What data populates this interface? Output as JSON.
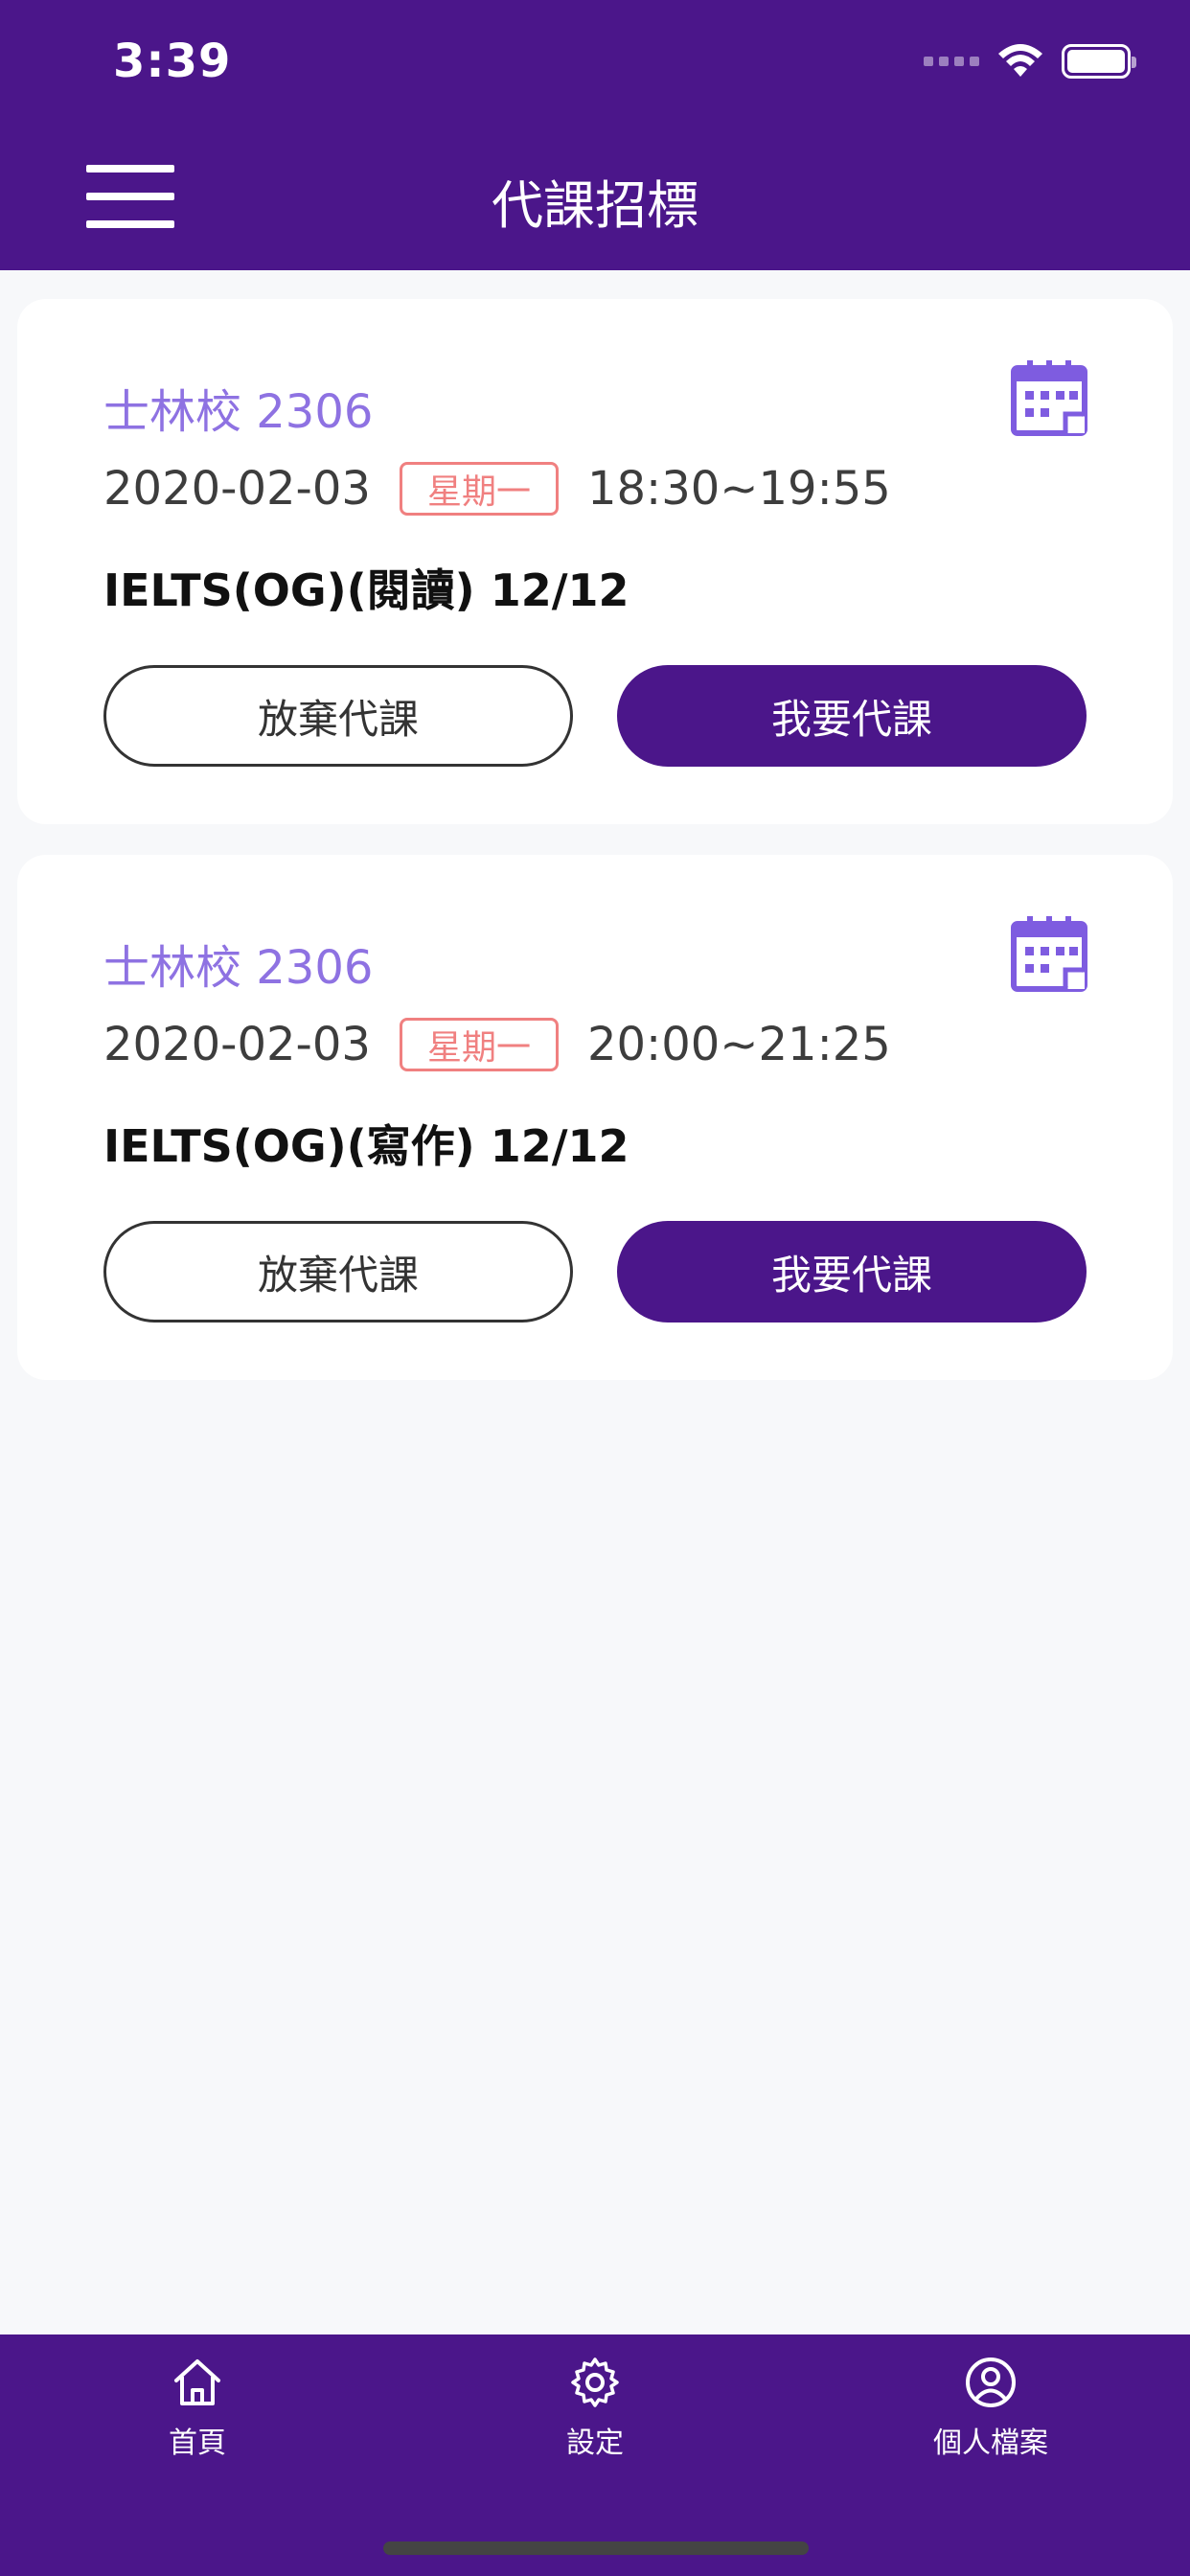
{
  "status_bar": {
    "time": "3:39"
  },
  "header": {
    "title": "代課招標"
  },
  "colors": {
    "primary": "#4b168a",
    "campus": "#8e72e2",
    "weekday": "#f08080",
    "background": "#f7f8fa"
  },
  "cards": [
    {
      "campus": "士林校 2306",
      "date": "2020-02-03",
      "weekday": "星期一",
      "time": "18:30~19:55",
      "course": "IELTS(OG)(閱讀) 12/12",
      "decline_label": "放棄代課",
      "accept_label": "我要代課"
    },
    {
      "campus": "士林校 2306",
      "date": "2020-02-03",
      "weekday": "星期一",
      "time": "20:00~21:25",
      "course": "IELTS(OG)(寫作) 12/12",
      "decline_label": "放棄代課",
      "accept_label": "我要代課"
    }
  ],
  "bottom_nav": {
    "items": [
      {
        "label": "首頁",
        "icon": "home-icon"
      },
      {
        "label": "設定",
        "icon": "gear-icon"
      },
      {
        "label": "個人檔案",
        "icon": "user-circle-icon"
      }
    ]
  }
}
